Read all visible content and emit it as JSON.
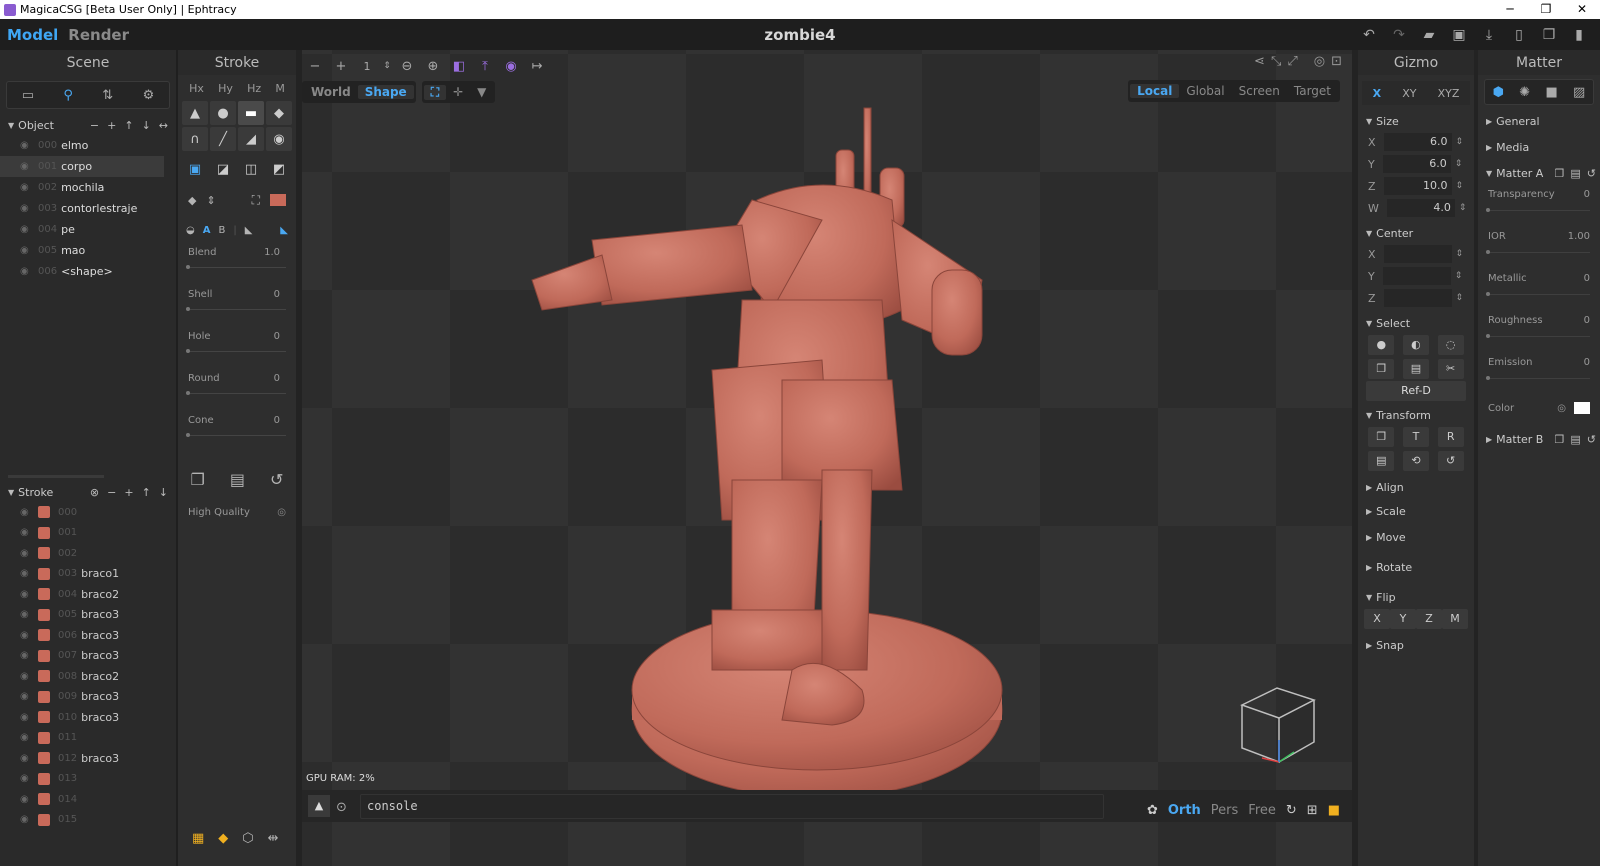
{
  "window": {
    "title": "MagicaCSG [Beta User Only] | Ephtracy",
    "minimize": "─",
    "restore": "❐",
    "close": "✕"
  },
  "menubar": {
    "model": "Model",
    "render": "Render",
    "doc_title": "zombie4"
  },
  "scene": {
    "title": "Scene",
    "object_header": "Object",
    "objects": [
      {
        "idx": "000",
        "name": "elmo"
      },
      {
        "idx": "001",
        "name": "corpo"
      },
      {
        "idx": "002",
        "name": "mochila"
      },
      {
        "idx": "003",
        "name": "contorlestraje"
      },
      {
        "idx": "004",
        "name": "pe"
      },
      {
        "idx": "005",
        "name": "mao"
      },
      {
        "idx": "006",
        "name": "<shape>"
      }
    ],
    "stroke_header": "Stroke",
    "strokes": [
      {
        "idx": "000",
        "name": ""
      },
      {
        "idx": "001",
        "name": ""
      },
      {
        "idx": "002",
        "name": ""
      },
      {
        "idx": "003",
        "name": "braco1"
      },
      {
        "idx": "004",
        "name": "braco2"
      },
      {
        "idx": "005",
        "name": "braco3"
      },
      {
        "idx": "006",
        "name": "braco3"
      },
      {
        "idx": "007",
        "name": "braco3"
      },
      {
        "idx": "008",
        "name": "braco2"
      },
      {
        "idx": "009",
        "name": "braco3"
      },
      {
        "idx": "010",
        "name": "braco3"
      },
      {
        "idx": "011",
        "name": ""
      },
      {
        "idx": "012",
        "name": "braco3"
      },
      {
        "idx": "013",
        "name": ""
      },
      {
        "idx": "014",
        "name": ""
      },
      {
        "idx": "015",
        "name": ""
      }
    ]
  },
  "stroke_panel": {
    "title": "Stroke",
    "cols": [
      "Hx",
      "Hy",
      "Hz",
      "M"
    ],
    "sliders": [
      {
        "label": "Blend",
        "value": "1.0"
      },
      {
        "label": "Shell",
        "value": "0"
      },
      {
        "label": "Hole",
        "value": "0"
      },
      {
        "label": "Round",
        "value": "0"
      },
      {
        "label": "Cone",
        "value": "0"
      }
    ],
    "high_quality": "High Quality",
    "ab": {
      "a": "A",
      "b": "B"
    }
  },
  "viewport": {
    "step_value": "1",
    "world": "World",
    "shape": "Shape",
    "coord_modes": [
      "Local",
      "Global",
      "Screen",
      "Target"
    ],
    "gpu_ram": "GPU RAM:  2%",
    "console": "console",
    "cam": {
      "orth": "Orth",
      "pers": "Pers",
      "free": "Free"
    }
  },
  "gizmo": {
    "title": "Gizmo",
    "axes": [
      "X",
      "XY",
      "XYZ"
    ],
    "size_header": "Size",
    "size": [
      {
        "k": "X",
        "v": "6.0"
      },
      {
        "k": "Y",
        "v": "6.0"
      },
      {
        "k": "Z",
        "v": "10.0"
      },
      {
        "k": "W",
        "v": "4.0"
      }
    ],
    "center_header": "Center",
    "center": [
      {
        "k": "X",
        "v": ""
      },
      {
        "k": "Y",
        "v": ""
      },
      {
        "k": "Z",
        "v": ""
      }
    ],
    "select_header": "Select",
    "refd": "Ref-D",
    "transform_header": "Transform",
    "t": "T",
    "r": "R",
    "align": "Align",
    "scale": "Scale",
    "move": "Move",
    "rotate": "Rotate",
    "flip_header": "Flip",
    "flip": [
      "X",
      "Y",
      "Z",
      "M"
    ],
    "snap": "Snap"
  },
  "matter": {
    "title": "Matter",
    "general": "General",
    "media": "Media",
    "matter_a": "Matter A",
    "props": [
      {
        "label": "Transparency",
        "value": "0"
      },
      {
        "label": "IOR",
        "value": "1.00"
      },
      {
        "label": "Metallic",
        "value": "0"
      },
      {
        "label": "Roughness",
        "value": "0"
      },
      {
        "label": "Emission",
        "value": "0"
      }
    ],
    "color_label": "Color",
    "matter_b": "Matter B"
  },
  "colors": {
    "accent": "#3fa7f5",
    "model": "#c96a5a"
  }
}
